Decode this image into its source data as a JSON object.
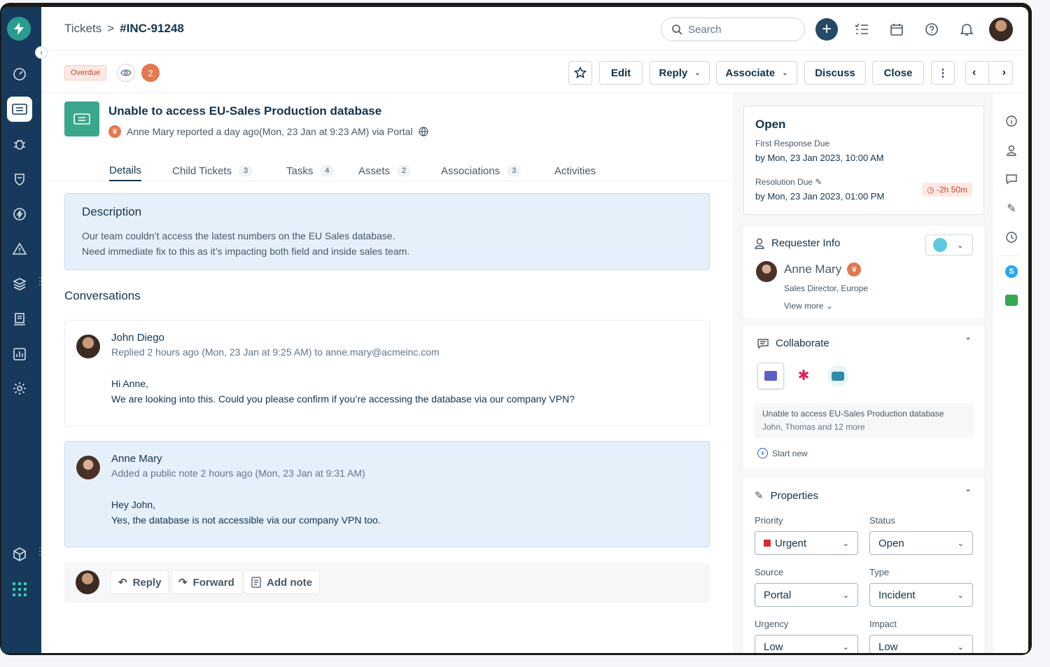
{
  "breadcrumb": {
    "root": "Tickets",
    "separator": ">",
    "current": "#INC-91248"
  },
  "search": {
    "placeholder": "Search"
  },
  "actionbar": {
    "overdue": "Overdue",
    "watchers_count": "2",
    "edit": "Edit",
    "reply": "Reply",
    "associate": "Associate",
    "discuss": "Discuss",
    "close": "Close"
  },
  "ticket": {
    "title": "Unable to access EU-Sales Production database",
    "meta": "Anne Mary reported a day ago(Mon, 23 Jan at 9:23 AM) via Portal"
  },
  "tabs": [
    {
      "label": "Details",
      "count": ""
    },
    {
      "label": "Child Tickets",
      "count": "3"
    },
    {
      "label": "Tasks",
      "count": "4"
    },
    {
      "label": "Assets",
      "count": "2"
    },
    {
      "label": "Associations",
      "count": "3"
    },
    {
      "label": "Activities",
      "count": ""
    }
  ],
  "description": {
    "heading": "Description",
    "line1": "Our team couldn’t access the latest numbers on the EU Sales database.",
    "line2": "Need immediate fix to this as it’s impacting both field and inside sales team."
  },
  "conversations": {
    "heading": "Conversations",
    "items": [
      {
        "name": "John Diego",
        "sub": "Replied 2 hours ago (Mon, 23 Jan at 9:25 AM) to anne.mary@acmeinc.com",
        "line1": "Hi Anne,",
        "line2": "We are looking into this. Could you please confirm if you’re accessing the database via our company VPN?"
      },
      {
        "name": "Anne Mary",
        "sub": "Added a public note 2 hours ago (Mon, 23 Jan at 9:31 AM)",
        "line1": "Hey John,",
        "line2": "Yes, the database is not accessible via our company VPN too."
      }
    ]
  },
  "replybar": {
    "reply": "Reply",
    "forward": "Forward",
    "add_note": "Add note"
  },
  "status": {
    "state": "Open",
    "first_response_label": "First Response Due",
    "first_response_value": "by Mon, 23 Jan 2023, 10:00 AM",
    "resolution_label": "Resolution Due",
    "resolution_value": "by Mon, 23 Jan 2023, 01:00 PM",
    "timer": "-2h 50m"
  },
  "requester": {
    "heading": "Requester Info",
    "name": "Anne Mary",
    "role": "Sales Director, Europe",
    "view_more": "View more"
  },
  "collaborate": {
    "heading": "Collaborate",
    "thread_title": "Unable to access EU-Sales Production database",
    "thread_members": "John, Thomas and 12 more",
    "start_new": "Start new"
  },
  "properties": {
    "heading": "Properties",
    "priority_label": "Priority",
    "priority": "Urgent",
    "status_label": "Status",
    "status": "Open",
    "source_label": "Source",
    "source": "Portal",
    "type_label": "Type",
    "type": "Incident",
    "urgency_label": "Urgency",
    "urgency": "Low",
    "impact_label": "Impact",
    "impact": "Low"
  },
  "colors": {
    "nav": "#173a5c",
    "accent": "#2c9c8f",
    "overdue": "#c2472b",
    "urgent": "#d72d30",
    "note_bg": "#e6f0fb"
  }
}
